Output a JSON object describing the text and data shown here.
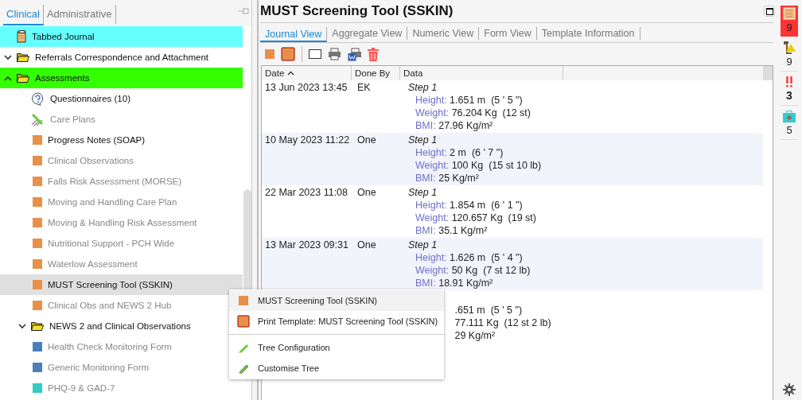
{
  "left_tabs": [
    {
      "label": "Clinical",
      "selected": true
    },
    {
      "label": "Administrative",
      "selected": false
    }
  ],
  "tree": [
    {
      "kind": "journal",
      "label": "Tabbed Journal",
      "color": "#66ffff",
      "selected": false,
      "disabled": false
    },
    {
      "kind": "folder",
      "label": "Referrals Correspondence and Attachment",
      "expanded": false,
      "selected": false,
      "disabled": false
    },
    {
      "kind": "folder",
      "label": "Assessments",
      "expanded": true,
      "color": "#33ff00",
      "selected": false,
      "disabled": false,
      "children": [
        {
          "kind": "questionnaire",
          "label": "Questionnaires (10)",
          "selected": false,
          "disabled": false
        },
        {
          "kind": "careplan",
          "label": "Care Plans",
          "selected": false,
          "disabled": true
        },
        {
          "kind": "form",
          "label": "Progress Notes (SOAP)",
          "color": "#e8904a",
          "selected": false,
          "disabled": false
        },
        {
          "kind": "form",
          "label": "Clinical Observations",
          "color": "#e8904a",
          "selected": false,
          "disabled": true
        },
        {
          "kind": "form",
          "label": "Falls Risk Assessment (MORSE)",
          "color": "#e8904a",
          "selected": false,
          "disabled": true
        },
        {
          "kind": "form",
          "label": "Moving and Handling Care Plan",
          "color": "#e8904a",
          "selected": false,
          "disabled": true
        },
        {
          "kind": "form",
          "label": "Moving & Handling Risk Assessment",
          "color": "#e8904a",
          "selected": false,
          "disabled": true
        },
        {
          "kind": "form",
          "label": "Nutritional Support - PCH Wide",
          "color": "#e8904a",
          "selected": false,
          "disabled": true
        },
        {
          "kind": "form",
          "label": "Waterlow Assessment",
          "color": "#e8904a",
          "selected": false,
          "disabled": true
        },
        {
          "kind": "form",
          "label": "MUST Screening Tool (SSKIN)",
          "color": "#e8904a",
          "selected": true,
          "disabled": false
        },
        {
          "kind": "form",
          "label": "Clinical Obs and NEWS 2 Hub",
          "color": "#e8904a",
          "selected": false,
          "disabled": true
        },
        {
          "kind": "folder",
          "label": "NEWS 2 and Clinical Observations",
          "expanded": false,
          "selected": false,
          "disabled": false
        },
        {
          "kind": "form",
          "label": "Health Check Monitoring Form",
          "color": "#4a7fba",
          "selected": false,
          "disabled": true
        },
        {
          "kind": "form",
          "label": "Generic Monitoring Form",
          "color": "#4a7fba",
          "selected": false,
          "disabled": true
        },
        {
          "kind": "form",
          "label": "PHQ-9 & GAD-7",
          "color": "#33ccc0",
          "selected": false,
          "disabled": true
        }
      ]
    }
  ],
  "title": "MUST Screening Tool (SSKIN)",
  "view_tabs": [
    {
      "label": "Journal View",
      "selected": true
    },
    {
      "label": "Aggregate View",
      "selected": false
    },
    {
      "label": "Numeric View",
      "selected": false
    },
    {
      "label": "Form View",
      "selected": false
    },
    {
      "label": "Template Information",
      "selected": false
    }
  ],
  "table": {
    "columns": [
      "Date",
      "Done By",
      "Data"
    ],
    "rows": [
      {
        "date": "13 Jun 2023 13:45",
        "done_by": "EK",
        "step": "Step 1",
        "readings": [
          {
            "label": "Height:",
            "value": "1.651 m  (5 ' 5 \")"
          },
          {
            "label": "Weight:",
            "value": "76.204 Kg  (12 st)"
          },
          {
            "label": "BMI:",
            "value": "27.96 Kg/m²"
          }
        ]
      },
      {
        "date": "10 May 2023 11:22",
        "done_by": "One",
        "step": "Step 1",
        "readings": [
          {
            "label": "Height:",
            "value": "2 m  (6 ' 7 \")"
          },
          {
            "label": "Weight:",
            "value": "100 Kg  (15 st 10 lb)"
          },
          {
            "label": "BMI:",
            "value": "25 Kg/m²"
          }
        ]
      },
      {
        "date": "22 Mar 2023 11:08",
        "done_by": "One",
        "step": "Step 1",
        "readings": [
          {
            "label": "Height:",
            "value": "1.854 m  (6 ' 1 \")"
          },
          {
            "label": "Weight:",
            "value": "120.657 Kg  (19 st)"
          },
          {
            "label": "BMI:",
            "value": "35.1 Kg/m²"
          }
        ]
      },
      {
        "date": "13 Mar 2023 09:31",
        "done_by": "One",
        "step": "Step 1",
        "readings": [
          {
            "label": "Height:",
            "value": "1.626 m  (5 ' 4 \")"
          },
          {
            "label": "Weight:",
            "value": "50 Kg  (7 st 12 lb)"
          },
          {
            "label": "BMI:",
            "value": "18.91 Kg/m²"
          }
        ]
      },
      {
        "readings": [
          {
            "value": ".651 m  (5 ' 5 \")"
          },
          {
            "value": "77.111 Kg  (12 st 2 lb)"
          },
          {
            "value": "29 Kg/m²"
          }
        ]
      }
    ]
  },
  "context_menu": [
    {
      "kind": "form",
      "label": "MUST Screening Tool (SSKIN)",
      "selected": true
    },
    {
      "kind": "print",
      "label": "Print Template: MUST Screening Tool (SSKIN)",
      "selected": false
    },
    {
      "kind": "separator"
    },
    {
      "kind": "config",
      "label": "Tree Configuration",
      "selected": false
    },
    {
      "kind": "customise",
      "label": "Customise Tree",
      "selected": false
    }
  ],
  "badges": [
    {
      "kind": "journal",
      "count": "9",
      "alert": true,
      "bold": false
    },
    {
      "kind": "warning",
      "count": "9",
      "alert": false,
      "bold": false
    },
    {
      "kind": "priority",
      "count": "3",
      "alert": false,
      "bold": true
    },
    {
      "kind": "medical",
      "count": "5",
      "alert": false,
      "bold": false
    }
  ]
}
